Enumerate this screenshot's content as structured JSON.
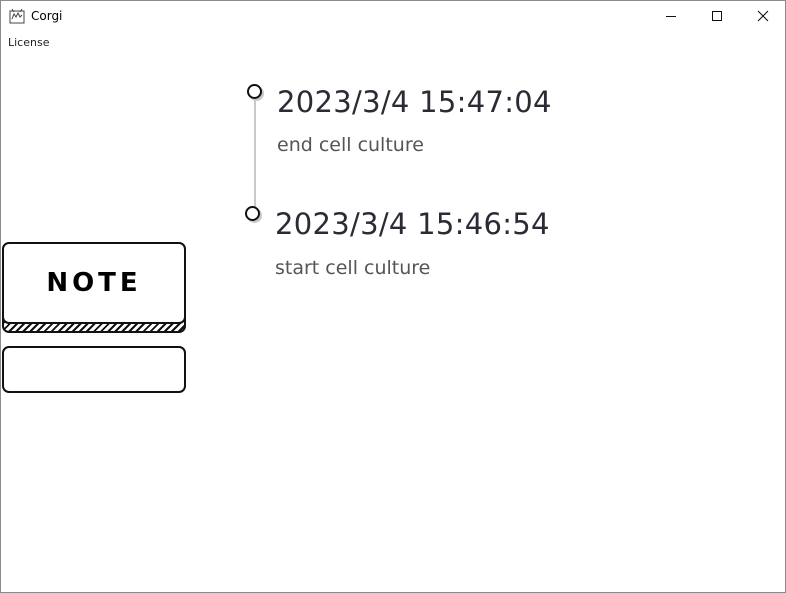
{
  "window": {
    "title": "Corgi"
  },
  "menu": {
    "items": [
      "License"
    ]
  },
  "timeline": [
    {
      "time": "2023/3/4 15:47:04",
      "description": "end cell culture"
    },
    {
      "time": "2023/3/4 15:46:54",
      "description": "start cell culture"
    }
  ],
  "note": {
    "button_label": "NOTE",
    "input_value": ""
  },
  "icons": {
    "app": "corgi-app-icon",
    "minimize": "minimize-icon",
    "maximize": "maximize-icon",
    "close": "close-icon"
  }
}
